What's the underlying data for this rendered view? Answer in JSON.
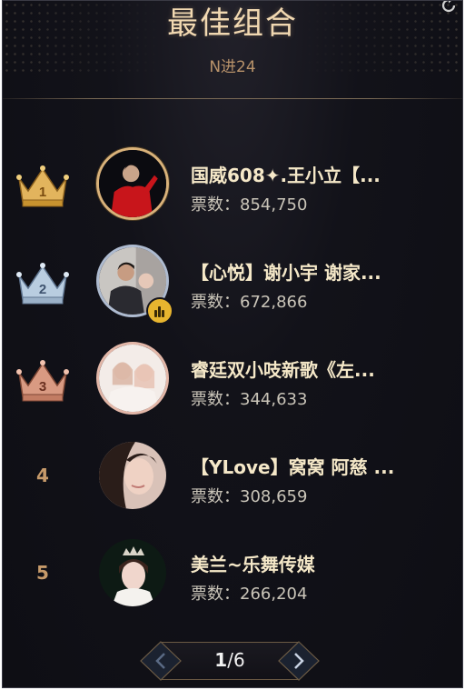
{
  "header": {
    "title": "最佳组合",
    "subtitle": "N进24"
  },
  "icons": {
    "refresh": "refresh-icon",
    "crown_1": "gold-crown-icon",
    "crown_2": "silver-crown-icon",
    "crown_3": "bronze-crown-icon",
    "badge": "sound-wave-badge-icon",
    "prev": "chevron-left-icon",
    "next": "chevron-right-icon"
  },
  "colors": {
    "background": "#121219",
    "gold": "#d9b27a",
    "silver": "#aebbd0",
    "bronze": "#e3b7a8",
    "name_text": "#f5e8c8",
    "rank_text": "#c69a6a"
  },
  "ranking": [
    {
      "rank": "1",
      "name": "国威608✦.王小立【...",
      "votes_label": "票数：854,750"
    },
    {
      "rank": "2",
      "name": "【心悦】谢小宇 谢家...",
      "votes_label": "票数：672,866"
    },
    {
      "rank": "3",
      "name": "睿廷双小吱新歌《左...",
      "votes_label": "票数：344,633"
    },
    {
      "rank": "4",
      "name": "【YLove】窝窝 阿慈 ...",
      "votes_label": "票数：308,659"
    },
    {
      "rank": "5",
      "name": "美兰~乐舞传媒",
      "votes_label": "票数：266,204"
    }
  ],
  "pagination": {
    "current": "1",
    "separator": "/",
    "total": "6"
  }
}
